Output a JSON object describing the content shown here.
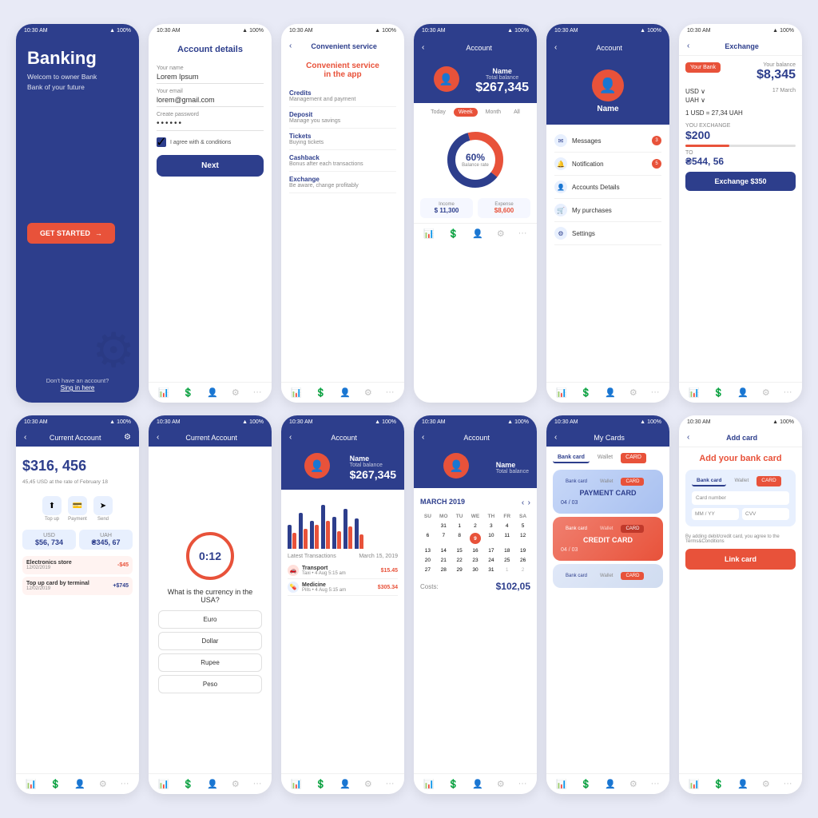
{
  "page": {
    "bg": "#e8eaf6"
  },
  "phones": {
    "banking": {
      "title": "Banking",
      "subtitle1": "Welcom to owner Bank",
      "subtitle2": "Bank of your future",
      "cta": "GET STARTED",
      "signin_prompt": "Don't have an account?",
      "signin_link": "Sing in here",
      "status_time": "10:30 AM",
      "status_battery": "100%"
    },
    "account_details": {
      "header_title": "Account details",
      "name_label": "Your name",
      "name_value": "Lorem Ipsum",
      "email_label": "Your email",
      "email_value": "lorem@gmail.com",
      "password_label": "Create password",
      "checkbox_label": "I agree with & conditions",
      "next_btn": "Next",
      "status_time": "10:30 AM"
    },
    "convenient": {
      "header_title": "Convenient service",
      "hero_title": "Convenient service",
      "hero_subtitle": "in the app",
      "services": [
        {
          "name": "Credits",
          "desc": "Management and payment"
        },
        {
          "name": "Deposit",
          "desc": "Manage you savings"
        },
        {
          "name": "Tickets",
          "desc": "Buying tickets"
        },
        {
          "name": "Cashback",
          "desc": "Bonus after each transactions"
        },
        {
          "name": "Exchange",
          "desc": "Be aware, change profitably"
        }
      ]
    },
    "account_week": {
      "header_title": "Account",
      "name": "Name",
      "balance_label": "Total balance",
      "balance": "$267,345",
      "tabs": [
        "Today",
        "Week",
        "Month",
        "All"
      ],
      "active_tab": "Week",
      "donut_pct": "60%",
      "donut_label": "Balance rate",
      "income_label": "Income",
      "income_value": "$ 11,300",
      "expense_label": "Expense",
      "expense_value": "$8,600"
    },
    "account_menu": {
      "header_title": "Account",
      "name": "Name",
      "menu_items": [
        {
          "icon": "✉",
          "text": "Messages",
          "badge": "3"
        },
        {
          "icon": "🔔",
          "text": "Notification",
          "badge": "5"
        },
        {
          "icon": "👤",
          "text": "Accounts Details",
          "badge": ""
        },
        {
          "icon": "🛒",
          "text": "My purchases",
          "badge": ""
        },
        {
          "icon": "⚙",
          "text": "Settings",
          "badge": ""
        }
      ]
    },
    "exchange": {
      "header_title": "Exchange",
      "bank_label": "Your Bank",
      "balance_label": "Your balance",
      "balance": "$8,345",
      "currency1": "USD ∨",
      "currency2": "UAH ∨",
      "date": "17 March",
      "rate": "1 USD = 27,34 UAH",
      "you_exchange_label": "YOU EXCHANGE",
      "you_exchange_amount": "$200",
      "to_label": "TO",
      "to_amount": "₴544, 56",
      "exchange_btn": "Exchange $350"
    },
    "current_account": {
      "header_title": "Current Account",
      "balance": "$316, 456",
      "rate_info": "45,45 USD at the rate of February 18",
      "actions": [
        "Top up",
        "Payment",
        "Send"
      ],
      "currencies": [
        {
          "name": "USD",
          "value": "$56, 734"
        },
        {
          "name": "UAH",
          "value": "₴345, 67"
        }
      ],
      "transactions": [
        {
          "name": "Electronics store",
          "date": "12/02/2019",
          "amount": "-$45"
        },
        {
          "name": "Top up card by terminal",
          "date": "12/02/2019",
          "amount": "+$745"
        }
      ]
    },
    "quiz": {
      "header_title": "Current Account",
      "timer": "0:12",
      "question": "What is the currency in the USA?",
      "options": [
        "Euro",
        "Dollar",
        "Rupee",
        "Peso"
      ]
    },
    "account_chart": {
      "header_title": "Account",
      "name": "Name",
      "balance_label": "Total balance",
      "balance": "$267,345",
      "chart_label": "Latest Transactions",
      "chart_date": "March 15, 2019",
      "transactions": [
        {
          "icon": "🚗",
          "name": "Transport",
          "sub": "Taxi",
          "date": "4 Aug 5:15 am",
          "amount": "$15.45"
        },
        {
          "icon": "💊",
          "name": "Medicine",
          "sub": "Pills",
          "date": "4 Aug 5:15 am",
          "amount": "$305.34"
        }
      ]
    },
    "calendar": {
      "header_title": "Account",
      "name": "Name",
      "balance_label": "Total balance",
      "month": "MARCH 2019",
      "day_headers": [
        "SU",
        "MO",
        "TU",
        "WE",
        "TH",
        "FR",
        "SA"
      ],
      "days_row1": [
        "",
        "31",
        "1",
        "2",
        "3",
        "4",
        "5"
      ],
      "days_row2": [
        "6",
        "7",
        "8",
        "9",
        "10",
        "11",
        "12"
      ],
      "days_row3": [
        "13",
        "14",
        "15",
        "16",
        "17",
        "18",
        "19"
      ],
      "days_row4": [
        "20",
        "21",
        "22",
        "23",
        "24",
        "25",
        "26"
      ],
      "days_row5": [
        "27",
        "28",
        "29",
        "30",
        "31",
        "1",
        "2"
      ],
      "today": "9",
      "costs_label": "Costs:",
      "costs_value": "$102,05"
    },
    "my_cards": {
      "header_title": "My Cards",
      "tabs": [
        "Bank card",
        "Wallet",
        "CARD"
      ],
      "cards": [
        {
          "type": "PAYMENT CARD",
          "date": "04 / 03",
          "color": "blue"
        },
        {
          "type": "CREDIT CARD",
          "date": "04 / 03",
          "color": "red"
        },
        {
          "type": "",
          "date": "",
          "color": "gray"
        }
      ]
    },
    "add_card": {
      "header_title": "Add card",
      "title": "Add your bank card",
      "tabs": [
        "Bank card",
        "Wallet",
        "CARD"
      ],
      "card_number_label": "Card number",
      "mm_label": "MM / YY",
      "cvv_label": "CVV",
      "terms": "By adding debit/credit card, you agree to the Terms&Conditions",
      "link_btn": "Link card"
    }
  },
  "nav": {
    "icons": [
      "📊",
      "💲",
      "👤",
      "⚙",
      "···"
    ]
  },
  "status": {
    "time": "10:30 AM",
    "battery": "100%",
    "wifi": "WiFi",
    "signal": "▲▲▲"
  }
}
